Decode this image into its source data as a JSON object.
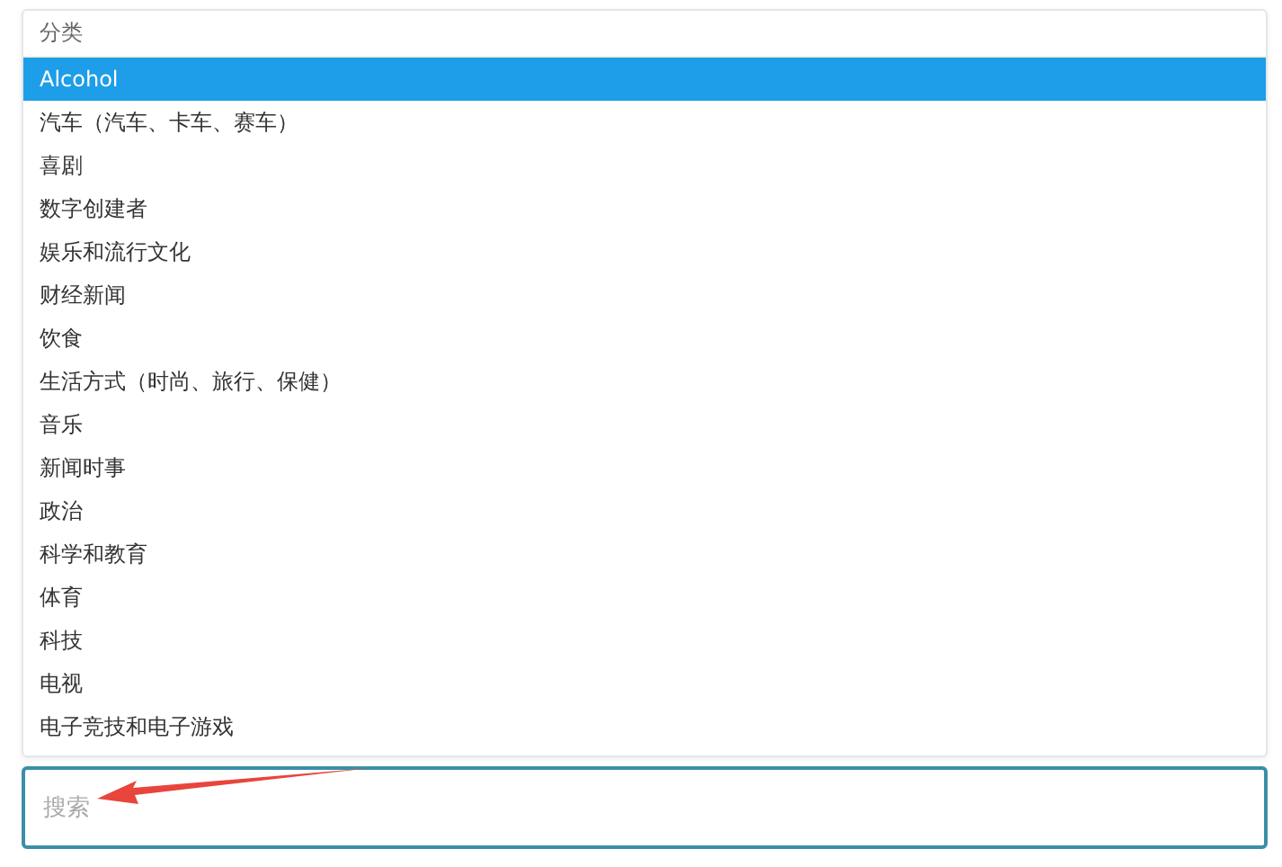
{
  "dropdown": {
    "group_label": "分类",
    "options": [
      {
        "label": "Alcohol",
        "selected": true
      },
      {
        "label": "汽车（汽车、卡车、赛车）",
        "selected": false
      },
      {
        "label": "喜剧",
        "selected": false
      },
      {
        "label": "数字创建者",
        "selected": false
      },
      {
        "label": "娱乐和流行文化",
        "selected": false
      },
      {
        "label": "财经新闻",
        "selected": false
      },
      {
        "label": "饮食",
        "selected": false
      },
      {
        "label": "生活方式（时尚、旅行、保健）",
        "selected": false
      },
      {
        "label": "音乐",
        "selected": false
      },
      {
        "label": "新闻时事",
        "selected": false
      },
      {
        "label": "政治",
        "selected": false
      },
      {
        "label": "科学和教育",
        "selected": false
      },
      {
        "label": "体育",
        "selected": false
      },
      {
        "label": "科技",
        "selected": false
      },
      {
        "label": "电视",
        "selected": false
      },
      {
        "label": "电子竞技和电子游戏",
        "selected": false
      }
    ]
  },
  "search": {
    "placeholder": "搜索",
    "focused": true
  },
  "annotation": {
    "kind": "arrow"
  }
}
